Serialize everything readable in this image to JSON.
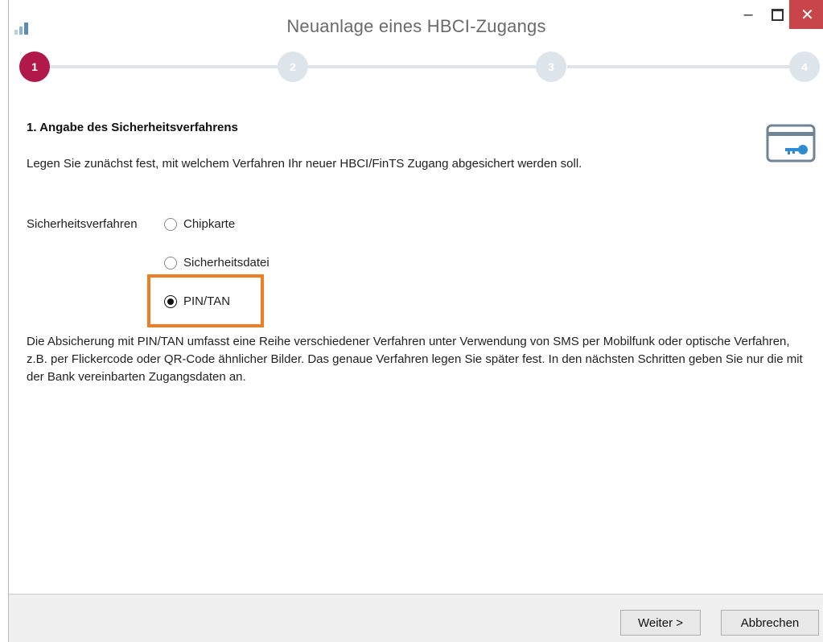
{
  "window": {
    "title": "Neuanlage eines HBCI-Zugangs",
    "close_glyph": "✕",
    "minimize_glyph": "–"
  },
  "stepper": {
    "steps": [
      "1",
      "2",
      "3",
      "4"
    ],
    "active_step": 1,
    "active_color": "#b0194a",
    "inactive_color": "#dde4ea"
  },
  "content": {
    "section_title": "1. Angabe des Sicherheitsverfahrens",
    "intro": "Legen Sie zunächst fest, mit welchem Verfahren Ihr neuer HBCI/FinTS Zugang abgesichert werden soll.",
    "field_label": "Sicherheitsverfahren",
    "options": [
      {
        "label": "Chipkarte",
        "checked": false
      },
      {
        "label": "Sicherheitsdatei",
        "checked": false
      },
      {
        "label": "PIN/TAN",
        "checked": true
      }
    ],
    "description": "Die Absicherung mit PIN/TAN umfasst eine Reihe verschiedener Verfahren unter Verwendung von SMS per Mobilfunk oder optische Verfahren, z.B. per Flickercode oder QR-Code ähnlicher Bilder. Das genaue Verfahren legen Sie später fest. In den nächsten Schritten geben Sie nur die mit der Bank vereinbarten Zugangsdaten an.",
    "icon": "security-card-key-icon",
    "highlight_color": "#ef7d22"
  },
  "footer": {
    "next_label": "Weiter >",
    "cancel_label": "Abbrechen"
  }
}
